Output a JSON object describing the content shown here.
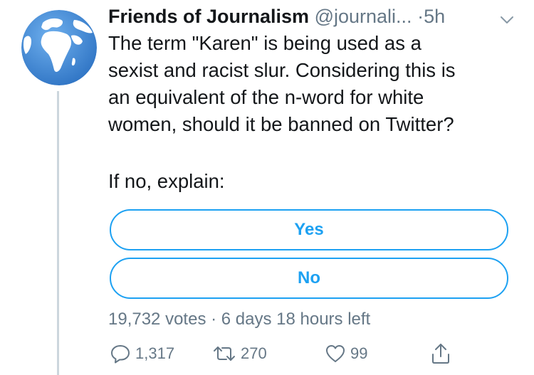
{
  "tweet": {
    "display_name": "Friends of Journalism",
    "handle": "@journali...",
    "separator": "·",
    "time": "5h",
    "body_lines": [
      "The term \"Karen\" is being used as a",
      "sexist and racist slur. Considering this is",
      "an equivalent of the n-word for white",
      "women, should it be banned on Twitter?"
    ],
    "followup": "If no, explain:"
  },
  "poll": {
    "options": [
      "Yes",
      "No"
    ],
    "meta": "19,732 votes · 6 days 18 hours left"
  },
  "actions": {
    "reply_count": "1,317",
    "retweet_count": "270",
    "like_count": "99"
  },
  "colors": {
    "accent": "#1da1f2",
    "muted": "#657786",
    "text": "#14171a",
    "thread_line": "#ccd6dd",
    "globe_ocean": "#4a8fd8",
    "globe_land": "#ffffff"
  },
  "icons": {
    "avatar": "globe-icon",
    "caret": "chevron-down-icon",
    "reply": "reply-icon",
    "retweet": "retweet-icon",
    "like": "heart-icon",
    "share": "share-icon"
  }
}
